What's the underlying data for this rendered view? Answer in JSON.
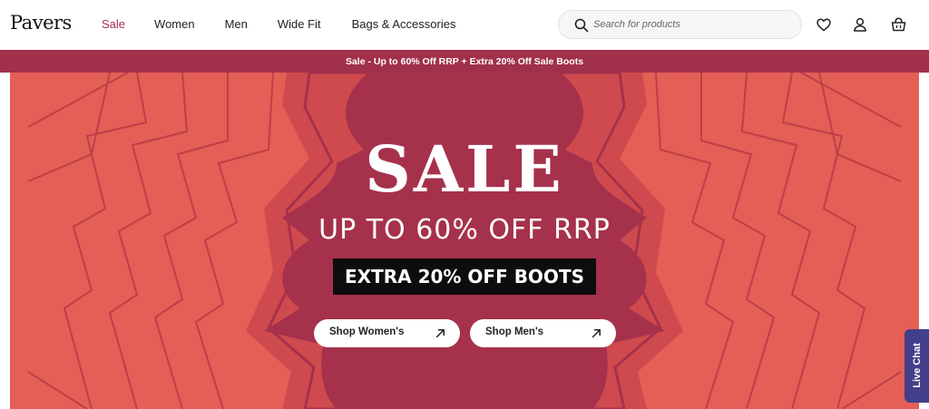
{
  "header": {
    "logo": "Pavers",
    "nav": [
      "Sale",
      "Women",
      "Men",
      "Wide Fit",
      "Bags & Accessories"
    ],
    "search_placeholder": "Search for products",
    "icons": [
      "search-icon",
      "heart-icon",
      "user-icon",
      "basket-icon"
    ]
  },
  "promo_bar": {
    "text": "Sale - Up to 60% Off RRP + Extra 20% Off Sale Boots"
  },
  "hero": {
    "title": "SALE",
    "subtitle": "UP TO 60% OFF RRP",
    "badge": "EXTRA 20% OFF BOOTS",
    "cta_women": "Shop Women's",
    "cta_men": "Shop Men's"
  },
  "live_chat": {
    "label": "Live Chat"
  },
  "colors": {
    "brand": "#a1304b",
    "hero_background": "#e45f55",
    "hero_inner": "#a6314b",
    "live_chat": "#433f8a"
  }
}
